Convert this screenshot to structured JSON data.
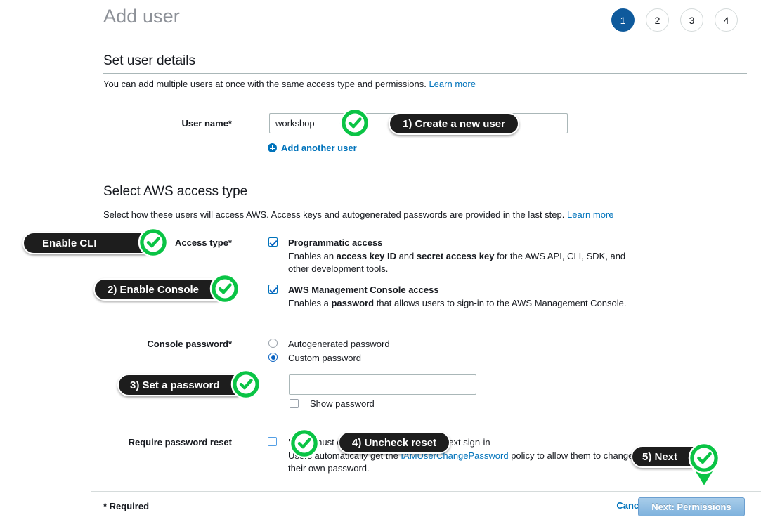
{
  "page": {
    "title": "Add user"
  },
  "steps": [
    {
      "label": "1",
      "active": true
    },
    {
      "label": "2",
      "active": false
    },
    {
      "label": "3",
      "active": false
    },
    {
      "label": "4",
      "active": false
    }
  ],
  "user_details": {
    "heading": "Set user details",
    "description": "You can add multiple users at once with the same access type and permissions.",
    "learn_more": "Learn more",
    "username_label": "User name*",
    "username_value": "workshop",
    "add_another_user": "Add another user"
  },
  "access_type": {
    "heading": "Select AWS access type",
    "description": "Select how these users will access AWS. Access keys and autogenerated passwords are provided in the last step.",
    "learn_more": "Learn more",
    "field_label": "Access type*",
    "programmatic": {
      "title": "Programmatic access",
      "desc_1": "Enables an ",
      "desc_b1": "access key ID",
      "desc_2": " and ",
      "desc_b2": "secret access key",
      "desc_3": " for the AWS API, CLI, SDK, and other development tools.",
      "checked": true
    },
    "console": {
      "title": "AWS Management Console access",
      "desc_1": "Enables a ",
      "desc_b1": "password",
      "desc_2": " that allows users to sign-in to the AWS Management Console.",
      "checked": true
    }
  },
  "console_password": {
    "label": "Console password*",
    "autogenerated_option": "Autogenerated password",
    "custom_option": "Custom password",
    "selected": "custom",
    "password_value": "",
    "show_password_label": "Show password",
    "show_password_checked": false
  },
  "password_reset": {
    "label": "Require password reset",
    "checked": false,
    "desc_1": "Users must create a new password at next sign-in",
    "desc_2a": "Users automatically get the ",
    "desc_link": "IAMUserChangePassword",
    "desc_2b": " policy to allow them to change their own password."
  },
  "footer": {
    "required_note": "* Required",
    "cancel": "Cancel",
    "next": "Next: Permissions"
  },
  "annotations": [
    {
      "id": "a1",
      "label": "1) Create a new user",
      "direction": "left"
    },
    {
      "id": "a2",
      "label": "Enable CLI",
      "direction": "right"
    },
    {
      "id": "a3",
      "label": "2) Enable Console",
      "direction": "right"
    },
    {
      "id": "a4",
      "label": "3) Set a password",
      "direction": "right"
    },
    {
      "id": "a5",
      "label": "4) Uncheck reset",
      "direction": "left"
    },
    {
      "id": "a6",
      "label": "5) Next",
      "direction": "down"
    }
  ],
  "colors": {
    "accent_blue": "#0073bb",
    "active_step": "#0f5a9c",
    "annotation_green": "#0ac445",
    "annotation_pill": "#1d1d1d",
    "title_gray": "#8d9198"
  }
}
